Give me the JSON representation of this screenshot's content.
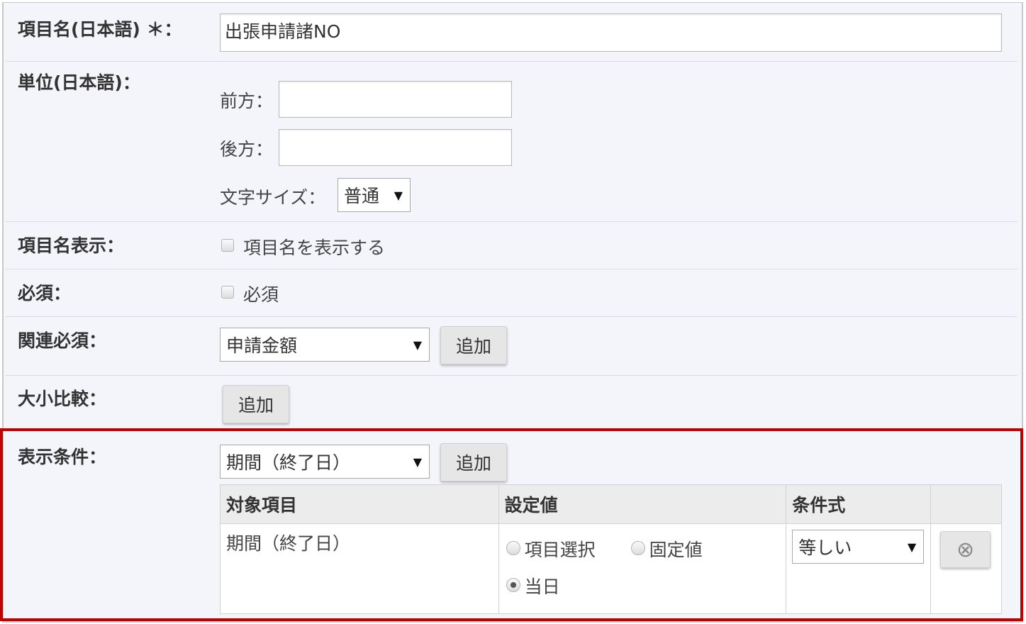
{
  "fields": {
    "item_name": {
      "label": "項目名(日本語) ＊：",
      "value": "出張申請諸NO"
    },
    "unit": {
      "label": "単位(日本語)：",
      "prefix_label": "前方：",
      "prefix_value": "",
      "suffix_label": "後方：",
      "suffix_value": "",
      "font_size_label": "文字サイズ：",
      "font_size_value": "普通"
    },
    "show_item_name": {
      "label": "項目名表示：",
      "checkbox_label": "項目名を表示する",
      "checked": false
    },
    "required": {
      "label": "必須：",
      "checkbox_label": "必須",
      "checked": false
    },
    "related_required": {
      "label": "関連必須：",
      "select_value": "申請金額",
      "add_label": "追加"
    },
    "comparison": {
      "label": "大小比較：",
      "add_label": "追加"
    },
    "display_condition": {
      "label": "表示条件：",
      "select_value": "期間（終了日）",
      "add_label": "追加",
      "table": {
        "headers": [
          "対象項目",
          "設定値",
          "条件式",
          ""
        ],
        "rows": [
          {
            "target": "期間（終了日）",
            "options": [
              {
                "label": "項目選択",
                "selected": false
              },
              {
                "label": "固定値",
                "selected": false
              },
              {
                "label": "当日",
                "selected": true
              }
            ],
            "condition": "等しい"
          }
        ]
      }
    }
  },
  "colors": {
    "highlight": "#c00000",
    "panel_bg": "#f4f4fb",
    "header_bg": "#ececec"
  },
  "icons": {
    "select_caret": "▼",
    "remove": "⊗"
  }
}
